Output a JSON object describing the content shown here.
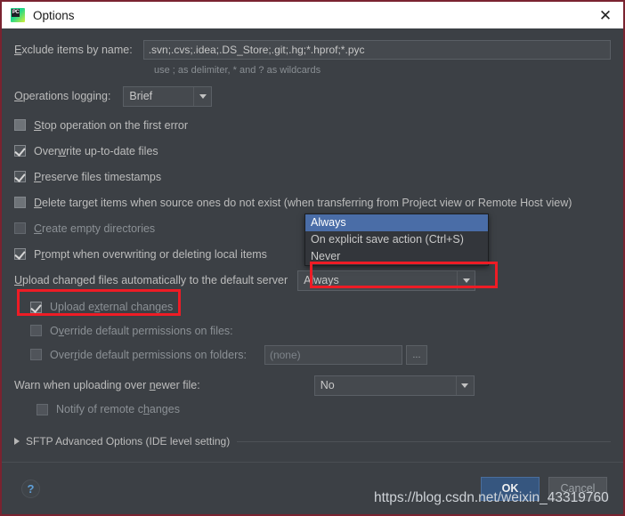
{
  "window": {
    "title": "Options",
    "app_icon": "pycharm-icon",
    "icon_text": "PC",
    "close_icon": "close-icon",
    "border_color": "#7a2330"
  },
  "form": {
    "exclude": {
      "label": "Exclude items by name:",
      "label_mnemonic": "E",
      "value": ".svn;.cvs;.idea;.DS_Store;.git;.hg;*.hprof;*.pyc",
      "hint": "use ; as delimiter, * and ? as wildcards"
    },
    "operations_logging": {
      "label": "Operations logging:",
      "label_mnemonic": "O",
      "value": "Brief",
      "arrow_icon": "chevron-down-icon"
    },
    "checkboxes": [
      {
        "label": "Stop operation on the first error",
        "checked": false,
        "enabled": true,
        "indent": false
      },
      {
        "label": "Overwrite up-to-date files",
        "checked": true,
        "enabled": true,
        "indent": false
      },
      {
        "label": "Preserve files timestamps",
        "checked": true,
        "enabled": true,
        "indent": false
      },
      {
        "label": "Delete target items when source ones do not exist (when transferring from Project view or Remote Host view)",
        "checked": false,
        "enabled": true,
        "indent": false
      },
      {
        "label": "Create empty directories",
        "checked": false,
        "enabled": false,
        "indent": false
      },
      {
        "label": "Prompt when overwriting or deleting local items",
        "checked": true,
        "enabled": true,
        "indent": false
      }
    ],
    "upload_auto": {
      "label": "Upload changed files automatically to the default server",
      "label_mnemonic": "U",
      "value": "Always",
      "arrow_icon": "chevron-down-icon",
      "options": [
        "Always",
        "On explicit save action (Ctrl+S)",
        "Never"
      ],
      "selected_option": "Always"
    },
    "upload_external": {
      "label": "Upload external changes",
      "checked": true,
      "enabled": false
    },
    "override_files": {
      "label": "Override default permissions on files:",
      "checked": false,
      "enabled": false
    },
    "override_folders": {
      "label": "Override default permissions on folders:",
      "checked": false,
      "enabled": false,
      "value": "(none)",
      "browse_label": "...",
      "browse_icon": "ellipsis-icon"
    },
    "warn_newer": {
      "label": "Warn when uploading over newer file:",
      "label_mnemonic": "n",
      "value": "No",
      "arrow_icon": "chevron-down-icon"
    },
    "notify_remote": {
      "label": "Notify of remote changes",
      "checked": false,
      "enabled": false
    },
    "sftp_advanced": {
      "label": "SFTP Advanced Options (IDE level setting)",
      "expander_icon": "triangle-right-icon",
      "expanded": false
    }
  },
  "footer": {
    "help_label": "?",
    "help_icon": "help-icon",
    "ok_label": "OK",
    "cancel_label": "Cancel"
  },
  "annotations": {
    "highlight_color": "#ee1c25",
    "watermark": "https://blog.csdn.net/weixin_43319760"
  }
}
